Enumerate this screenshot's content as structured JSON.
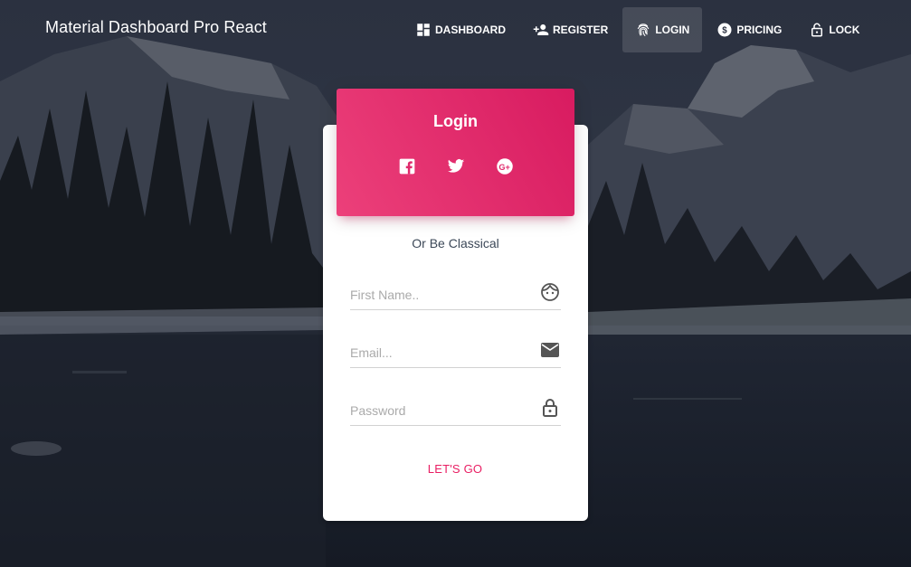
{
  "brand": "Material Dashboard Pro React",
  "nav": [
    {
      "label": "DASHBOARD",
      "icon": "dashboard-icon"
    },
    {
      "label": "REGISTER",
      "icon": "person-add-icon"
    },
    {
      "label": "LOGIN",
      "icon": "fingerprint-icon",
      "active": true
    },
    {
      "label": "PRICING",
      "icon": "monetization-icon"
    },
    {
      "label": "LOCK",
      "icon": "lock-open-icon"
    }
  ],
  "card": {
    "title": "Login",
    "social": [
      "facebook-icon",
      "twitter-icon",
      "google-plus-icon"
    ],
    "subtitle": "Or Be Classical",
    "fields": [
      {
        "placeholder": "First Name..",
        "icon": "face-icon"
      },
      {
        "placeholder": "Email...",
        "icon": "email-icon"
      },
      {
        "placeholder": "Password",
        "icon": "lock-outline-icon"
      }
    ],
    "submit_label": "LET'S GO"
  },
  "colors": {
    "accent": "#e91e63",
    "header_gradient_start": "#ec407a",
    "header_gradient_end": "#d81b60",
    "background": "#1a1f2b"
  }
}
